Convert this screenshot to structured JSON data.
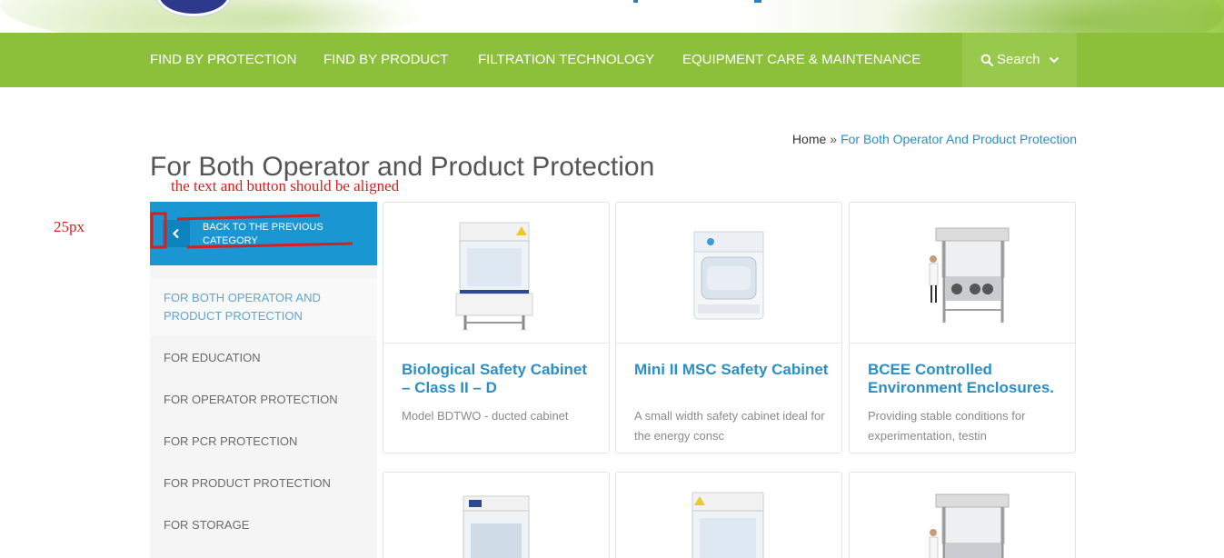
{
  "nav": {
    "items": [
      {
        "label": "FIND BY PROTECTION"
      },
      {
        "label": "FIND BY PRODUCT"
      },
      {
        "label": "FILTRATION TECHNOLOGY"
      },
      {
        "label": "EQUIPMENT CARE & MAINTENANCE"
      }
    ],
    "search_label": "Search"
  },
  "colors": {
    "nav_bg": "#8cc03a",
    "accent_blue": "#1a96d3",
    "link_blue": "#2b8fc5",
    "annotation_red": "#d61f1f"
  },
  "breadcrumb": {
    "home": "Home",
    "separator": "»",
    "current": "For Both Operator And Product Protection"
  },
  "page_title": "For Both Operator and Product Protection",
  "annotations": {
    "note": "the text and button should be aligned",
    "spacing": "25px"
  },
  "sidebar": {
    "back_label": "BACK TO THE PREVIOUS CATEGORY",
    "items": [
      {
        "label": "FOR BOTH OPERATOR AND PRODUCT PROTECTION",
        "active": true
      },
      {
        "label": "FOR EDUCATION"
      },
      {
        "label": "FOR OPERATOR PROTECTION"
      },
      {
        "label": "FOR PCR PROTECTION"
      },
      {
        "label": "FOR PRODUCT PROTECTION"
      },
      {
        "label": "FOR STORAGE"
      }
    ]
  },
  "products": [
    {
      "name": "Biological Safety Cabinet – Class II – D",
      "desc": "Model BDTWO - ducted cabinet"
    },
    {
      "name": "Mini II MSC Safety Cabinet",
      "desc": "A small width safety cabinet ideal for the energy consc"
    },
    {
      "name": "BCEE Controlled Environment Enclosures.",
      "desc": "Providing stable conditions for experimentation, testin"
    }
  ]
}
